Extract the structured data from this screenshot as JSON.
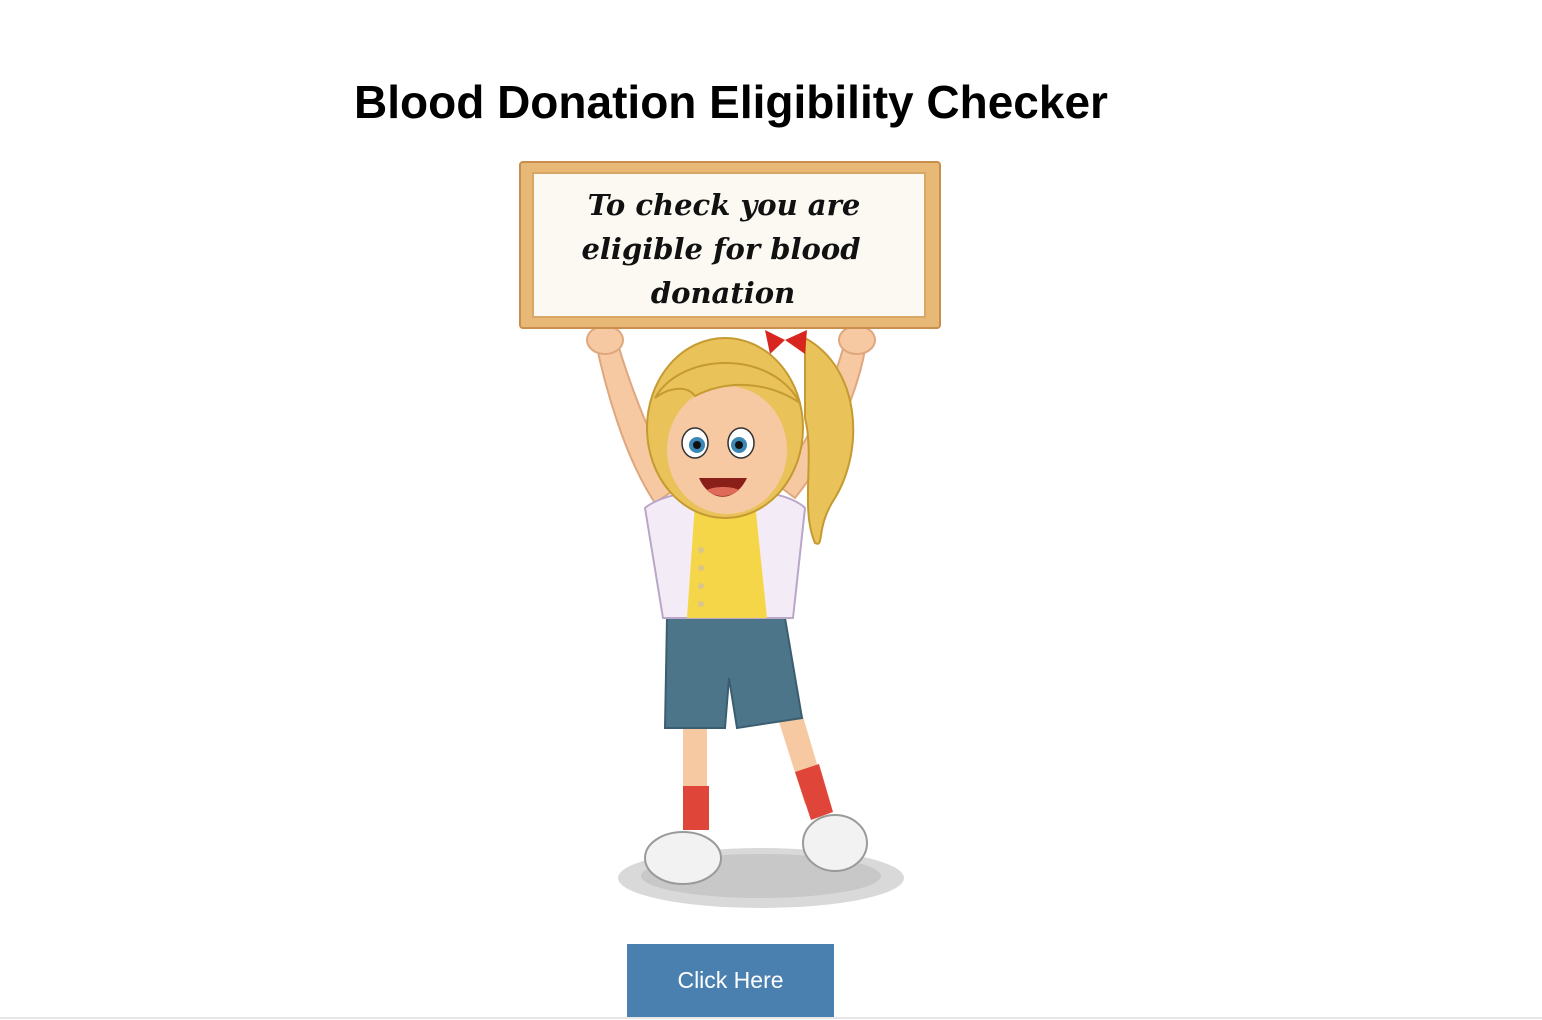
{
  "page": {
    "title": "Blood Donation Eligibility Checker"
  },
  "illustration": {
    "subject": "girl-holding-sign",
    "sign_lines": [
      "To check you are",
      "eligible for blood",
      "donation"
    ]
  },
  "cta": {
    "label": "Click Here"
  },
  "colors": {
    "button_bg": "#4a80b0",
    "button_text": "#ffffff",
    "sign_frame": "#e8b877",
    "sign_board": "#fbf9f1"
  }
}
